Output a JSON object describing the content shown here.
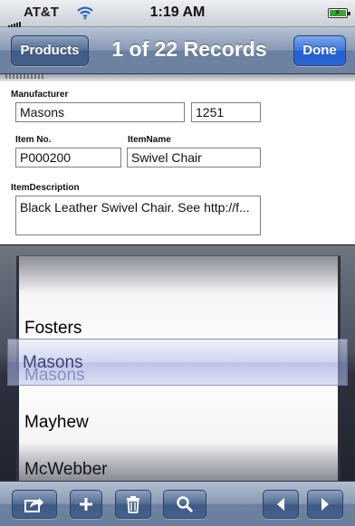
{
  "status_bar": {
    "carrier": "AT&T",
    "time": "1:19 AM"
  },
  "nav": {
    "back_label": "Products",
    "title": "1 of 22 Records",
    "done_label": "Done"
  },
  "form": {
    "manufacturer_label": "Manufacturer",
    "manufacturer_value": "Masons",
    "manufacturer_id": "1251",
    "item_no_label": "Item No.",
    "item_no_value": "P000200",
    "item_name_label": "ItemName",
    "item_name_value": "Swivel Chair",
    "item_description_label": "ItemDescription",
    "item_description_value": "Black Leather Swivel Chair. See http://f..."
  },
  "picker": {
    "options": [
      "Fosters",
      "Masons",
      "Mayhew",
      "McWebber"
    ],
    "selected": "Masons"
  },
  "toolbar": {
    "icons": [
      "share-icon",
      "add-icon",
      "trash-icon",
      "search-icon",
      "previous-icon",
      "next-icon"
    ]
  },
  "colors": {
    "nav_blue": "#6d82a0",
    "done_blue": "#2a67d6",
    "battery_green": "#3aa235"
  }
}
